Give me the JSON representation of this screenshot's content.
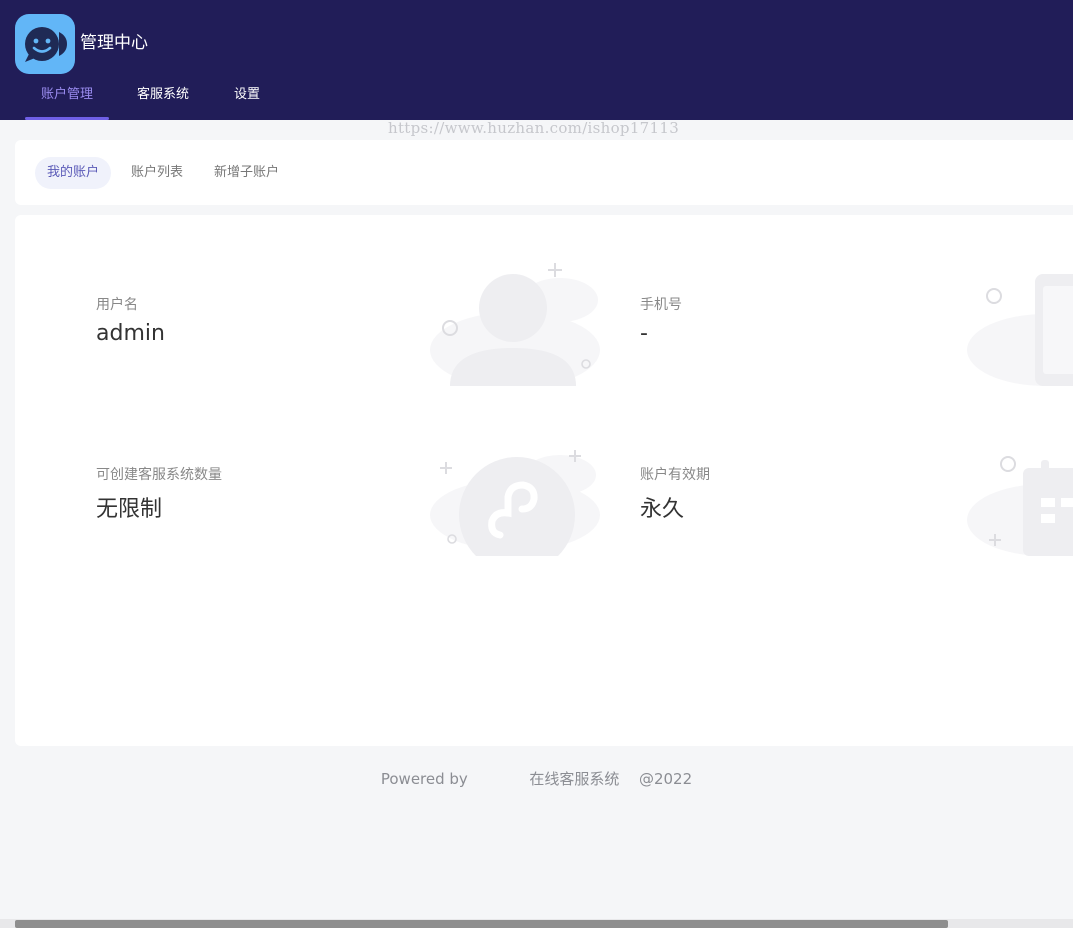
{
  "header": {
    "app_title": "管理中心",
    "nav": [
      {
        "label": "账户管理",
        "active": true
      },
      {
        "label": "客服系统",
        "active": false
      },
      {
        "label": "设置",
        "active": false
      }
    ]
  },
  "watermark": "https://www.huzhan.com/ishop17113",
  "subtabs": [
    {
      "label": "我的账户",
      "active": true
    },
    {
      "label": "账户列表",
      "active": false
    },
    {
      "label": "新增子账户",
      "active": false
    }
  ],
  "account": {
    "username_label": "用户名",
    "username_value": "admin",
    "phone_label": "手机号",
    "phone_value": "-",
    "quota_label": "可创建客服系统数量",
    "quota_value": "无限制",
    "validity_label": "账户有效期",
    "validity_value": "永久"
  },
  "footer": {
    "powered_by": "Powered by",
    "product": "在线客服系统",
    "year": "@2022"
  },
  "icons": {
    "logo": "chat-smile-icon",
    "user_illustration": "user-icon",
    "phone_illustration": "phone-icon",
    "mini_program_illustration": "mini-program-icon",
    "calendar_illustration": "calendar-icon"
  },
  "colors": {
    "header_bg": "#211d58",
    "accent": "#6f5fe6",
    "logo_bg": "#62b6f7"
  }
}
